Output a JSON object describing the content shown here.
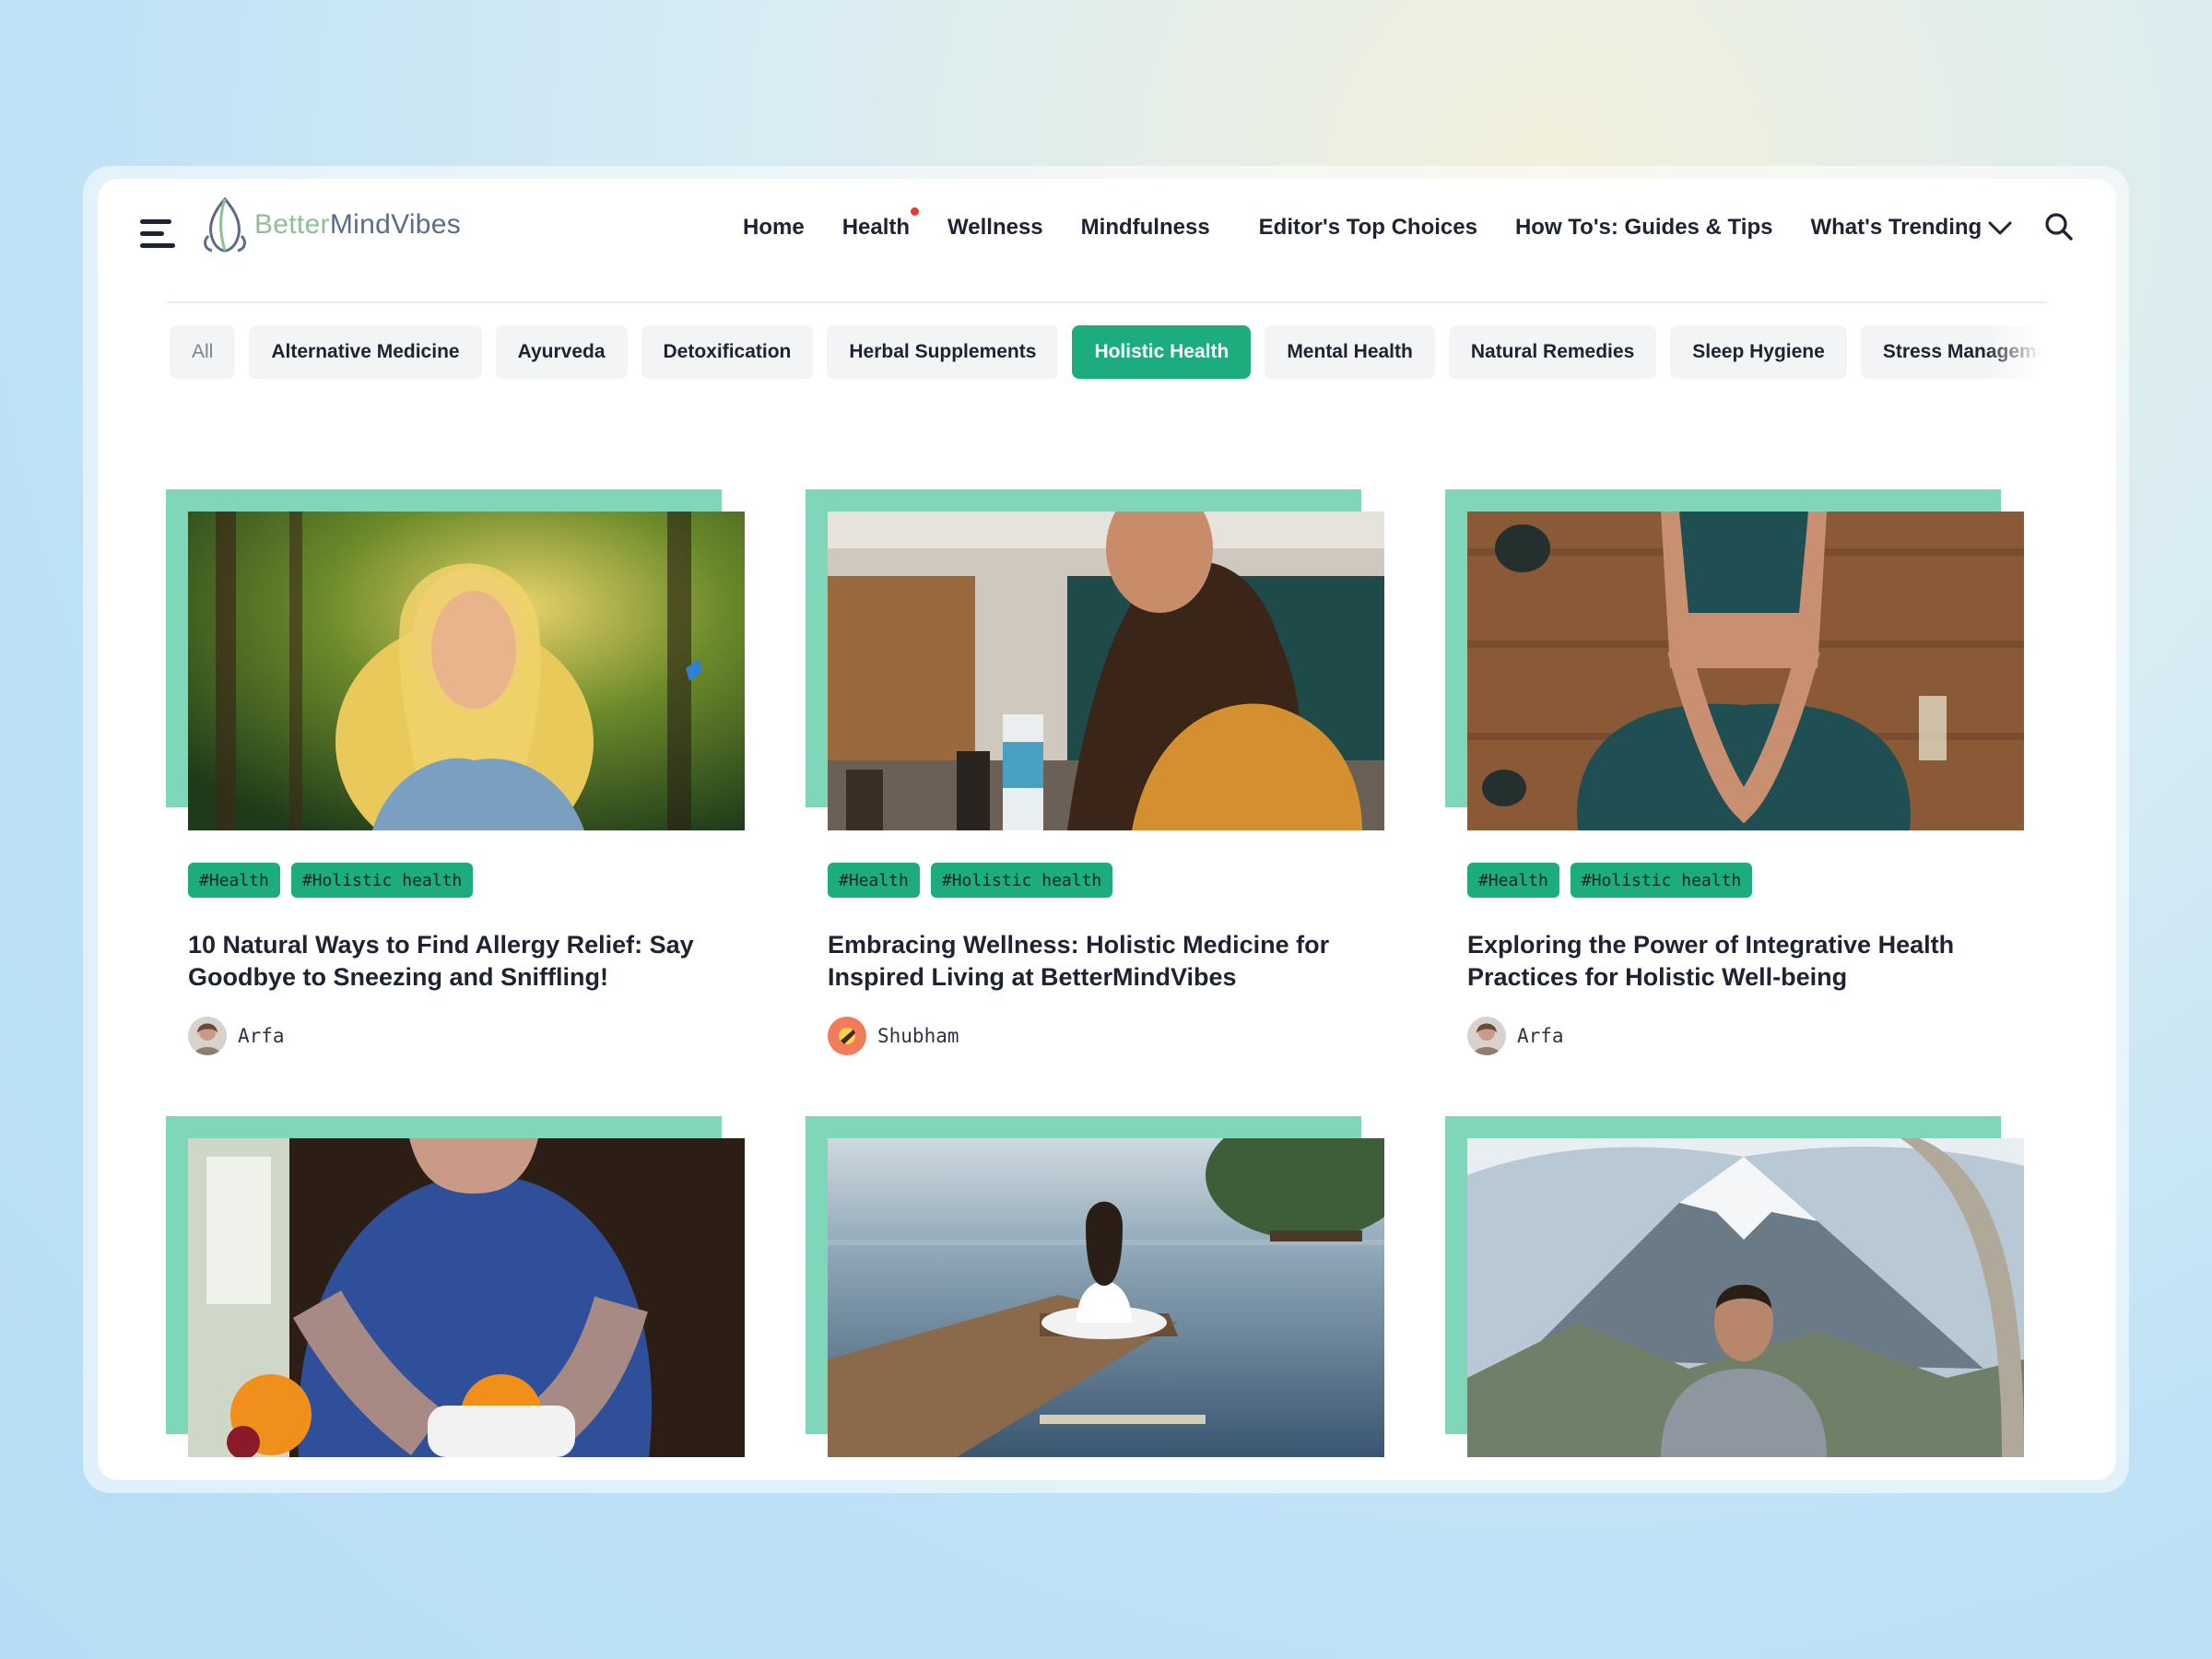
{
  "brand": {
    "prefix": "Better",
    "rest": "MindVibes"
  },
  "nav": {
    "items": [
      "Home",
      "Health",
      "Wellness",
      "Mindfulness",
      "Editor's Top Choices",
      "How To's: Guides & Tips",
      "What's Trending"
    ],
    "notification_on": "Health"
  },
  "categories": {
    "items": [
      "All",
      "Alternative Medicine",
      "Ayurveda",
      "Detoxification",
      "Herbal Supplements",
      "Holistic Health",
      "Mental Health",
      "Natural Remedies",
      "Sleep Hygiene",
      "Stress Management"
    ],
    "active": "Holistic Health"
  },
  "colors": {
    "accent": "#1dac7e",
    "card_accent": "#7fd6b8",
    "text": "#1d2330"
  },
  "articles": [
    {
      "tags": [
        "#Health",
        "#Holistic health"
      ],
      "title": "10 Natural Ways to Find Allergy Relief: Say Goodbye to Sneezing and Sniffling!",
      "author": "Arfa",
      "image": "woman-in-forest-photo"
    },
    {
      "tags": [
        "#Health",
        "#Holistic health"
      ],
      "title": "Embracing Wellness: Holistic Medicine for Inspired Living at BetterMindVibes",
      "author": "Shubham",
      "image": "woman-in-kitchen-photo"
    },
    {
      "tags": [
        "#Health",
        "#Holistic health"
      ],
      "title": "Exploring the Power of Integrative Health Practices for Holistic Well-being",
      "author": "Arfa",
      "image": "woman-doing-yoga-photo"
    },
    {
      "image": "woman-holding-oranges-photo"
    },
    {
      "image": "meditation-on-dock-photo"
    },
    {
      "image": "man-before-mountain-photo"
    }
  ]
}
